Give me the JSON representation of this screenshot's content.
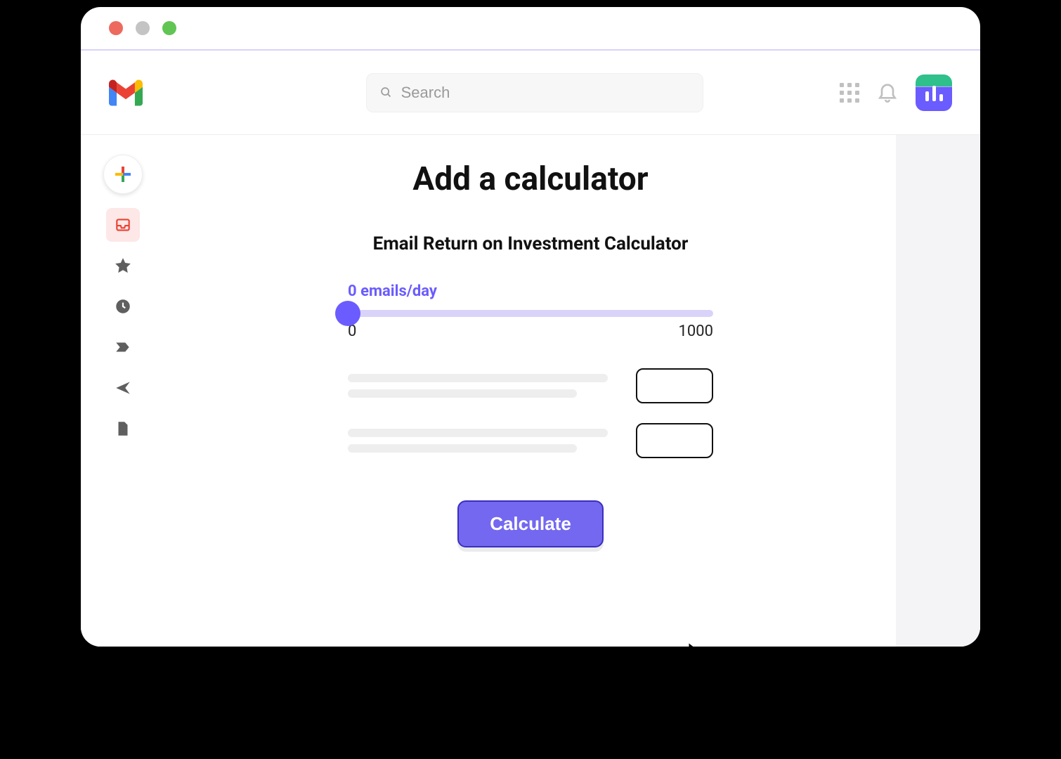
{
  "window": {
    "traffic": {
      "red": "#ed6a5e",
      "yellow": "#c4c4c4",
      "green": "#61c554"
    }
  },
  "topbar": {
    "search_placeholder": "Search"
  },
  "sidebar": {
    "items": [
      {
        "name": "inbox"
      },
      {
        "name": "starred"
      },
      {
        "name": "snoozed"
      },
      {
        "name": "important"
      },
      {
        "name": "sent"
      },
      {
        "name": "drafts"
      }
    ]
  },
  "page": {
    "title": "Add a calculator",
    "subtitle": "Email Return on Investment Calculator"
  },
  "slider": {
    "value_label": "0 emails/day",
    "min": "0",
    "max": "1000"
  },
  "form": {
    "input1_value": "",
    "input2_value": ""
  },
  "actions": {
    "calculate_label": "Calculate"
  },
  "colors": {
    "accent": "#6a5cff",
    "accent_track": "#d9d3fa",
    "button_bg": "#7468f0",
    "button_border": "#3a2fbf"
  }
}
